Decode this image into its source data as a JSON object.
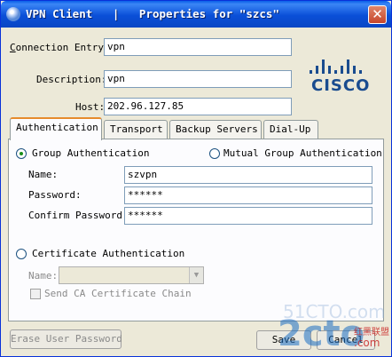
{
  "window": {
    "title": "VPN Client   |   Properties for \"szcs\"",
    "close_glyph": "✕"
  },
  "connection": {
    "entry_label": "Connection Entry:",
    "entry_value": "vpn",
    "description_label": "Description:",
    "description_value": "vpn",
    "host_label": "Host:",
    "host_value": "202.96.127.85"
  },
  "logo": {
    "word": "CISCO",
    "color": "#1a4c8f"
  },
  "tabs": [
    {
      "label": "Authentication"
    },
    {
      "label": "Transport"
    },
    {
      "label": "Backup Servers"
    },
    {
      "label": "Dial-Up"
    }
  ],
  "auth": {
    "group_radio_label": "Group Authentication",
    "mutual_radio_label": "Mutual Group Authentication",
    "name_label": "Name:",
    "name_value": "szvpn",
    "password_label": "Password:",
    "password_value": "******",
    "confirm_label": "Confirm Password:",
    "confirm_value": "******",
    "cert_radio_label": "Certificate Authentication",
    "cert_name_label": "Name:",
    "send_ca_label": "Send CA Certificate Chain",
    "selected": "Group Authentication"
  },
  "footer": {
    "erase_button": "Erase User Password",
    "save_button": "Save",
    "cancel_button": "Cancel"
  },
  "watermarks": {
    "site": "51CTO.com",
    "brand": "2cto",
    "cjk": "红黑联盟",
    "com": ".com"
  },
  "colors": {
    "title_bar": "#0a4fd8",
    "tab_highlight": "#e68b2c"
  }
}
